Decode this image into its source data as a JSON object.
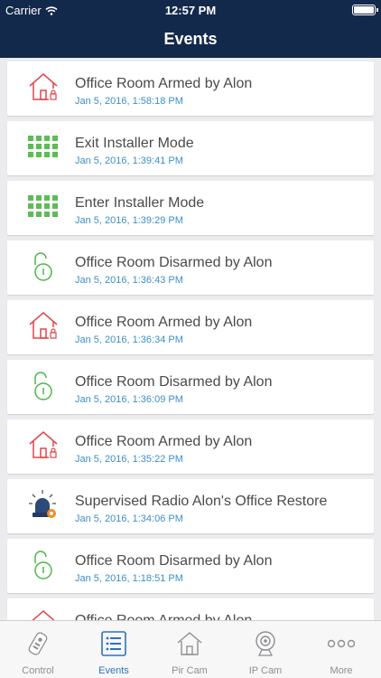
{
  "status_bar": {
    "carrier": "Carrier",
    "time": "12:57 PM"
  },
  "nav": {
    "title": "Events"
  },
  "events": [
    {
      "icon": "house-armed-icon",
      "title": "Office Room Armed by Alon",
      "date": "Jan 5, 2016, 1:58:18 PM"
    },
    {
      "icon": "keypad-icon",
      "title": "Exit Installer Mode",
      "date": "Jan 5, 2016, 1:39:41 PM"
    },
    {
      "icon": "keypad-icon",
      "title": "Enter Installer Mode",
      "date": "Jan 5, 2016, 1:39:29 PM"
    },
    {
      "icon": "unlock-icon",
      "title": "Office Room Disarmed by Alon",
      "date": "Jan 5, 2016, 1:36:43 PM"
    },
    {
      "icon": "house-armed-icon",
      "title": "Office Room Armed by Alon",
      "date": "Jan 5, 2016, 1:36:34 PM"
    },
    {
      "icon": "unlock-icon",
      "title": "Office Room Disarmed by Alon",
      "date": "Jan 5, 2016, 1:36:09 PM"
    },
    {
      "icon": "house-armed-icon",
      "title": "Office Room Armed by Alon",
      "date": "Jan 5, 2016, 1:35:22 PM"
    },
    {
      "icon": "siren-icon",
      "title": "Supervised Radio Alon's Office Restore",
      "date": "Jan 5, 2016, 1:34:06 PM"
    },
    {
      "icon": "unlock-icon",
      "title": "Office Room Disarmed by Alon",
      "date": "Jan 5, 2016, 1:18:51 PM"
    },
    {
      "icon": "house-armed-icon",
      "title": "Office Room Armed by Alon",
      "date": ""
    }
  ],
  "tabs": [
    {
      "label": "Control",
      "icon": "remote-control-icon"
    },
    {
      "label": "Events",
      "icon": "event-list-icon",
      "active": true
    },
    {
      "label": "Pir Cam",
      "icon": "house-outline-icon"
    },
    {
      "label": "IP Cam",
      "icon": "webcam-icon"
    },
    {
      "label": "More",
      "icon": "more-dots-icon"
    }
  ],
  "colors": {
    "nav": "#13294b",
    "armed": "#e0464b",
    "disarmed": "#4cb848",
    "keypad": "#5cbc55",
    "date": "#3d8fc6",
    "tab_active": "#2c72c2",
    "tab_inactive": "#8e8e93"
  }
}
